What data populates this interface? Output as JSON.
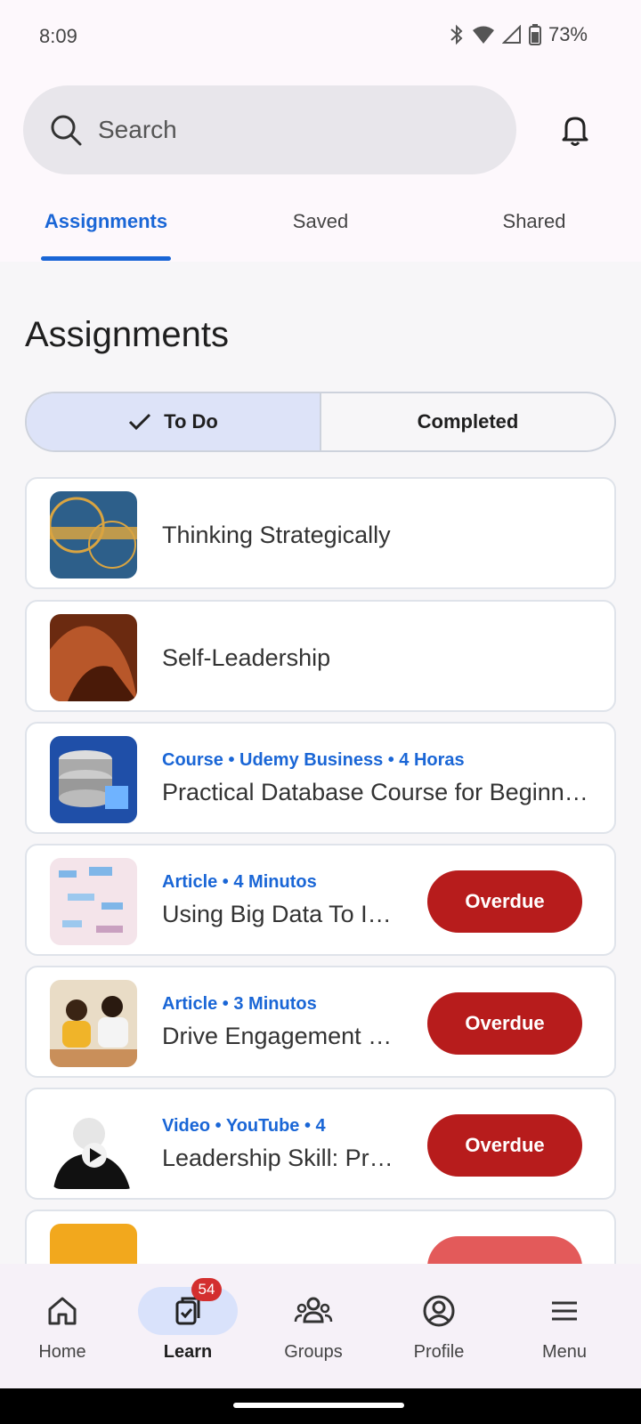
{
  "status_bar": {
    "time": "8:09",
    "battery": "73%"
  },
  "search": {
    "placeholder": "Search"
  },
  "tabs": [
    {
      "label": "Assignments",
      "active": true
    },
    {
      "label": "Saved",
      "active": false
    },
    {
      "label": "Shared",
      "active": false
    }
  ],
  "page": {
    "title": "Assignments"
  },
  "segmented": {
    "todo_label": "To Do",
    "completed_label": "Completed",
    "selected": "To Do"
  },
  "assignments": [
    {
      "meta": "",
      "title": "Thinking Strategically",
      "status": ""
    },
    {
      "meta": "",
      "title": "Self-Leadership",
      "status": ""
    },
    {
      "meta": "Course • Udemy Business • 4 Horas",
      "title": "Practical Database Course for Beginners",
      "status": ""
    },
    {
      "meta": "Article • 4 Minutos",
      "title": "Using Big Data To Improve",
      "status": "Overdue"
    },
    {
      "meta": "Article • 3 Minutos",
      "title": "Drive Engagement with",
      "status": "Overdue"
    },
    {
      "meta": "Video • YouTube • 4",
      "title": "Leadership Skill: Practice",
      "status": "Overdue"
    }
  ],
  "bottom_nav": [
    {
      "label": "Home",
      "active": false
    },
    {
      "label": "Learn",
      "active": true,
      "badge": "54"
    },
    {
      "label": "Groups",
      "active": false
    },
    {
      "label": "Profile",
      "active": false
    },
    {
      "label": "Menu",
      "active": false
    }
  ],
  "colors": {
    "accent": "#1a66d6",
    "overdue": "#b71c1c",
    "badge": "#d32f2f"
  }
}
